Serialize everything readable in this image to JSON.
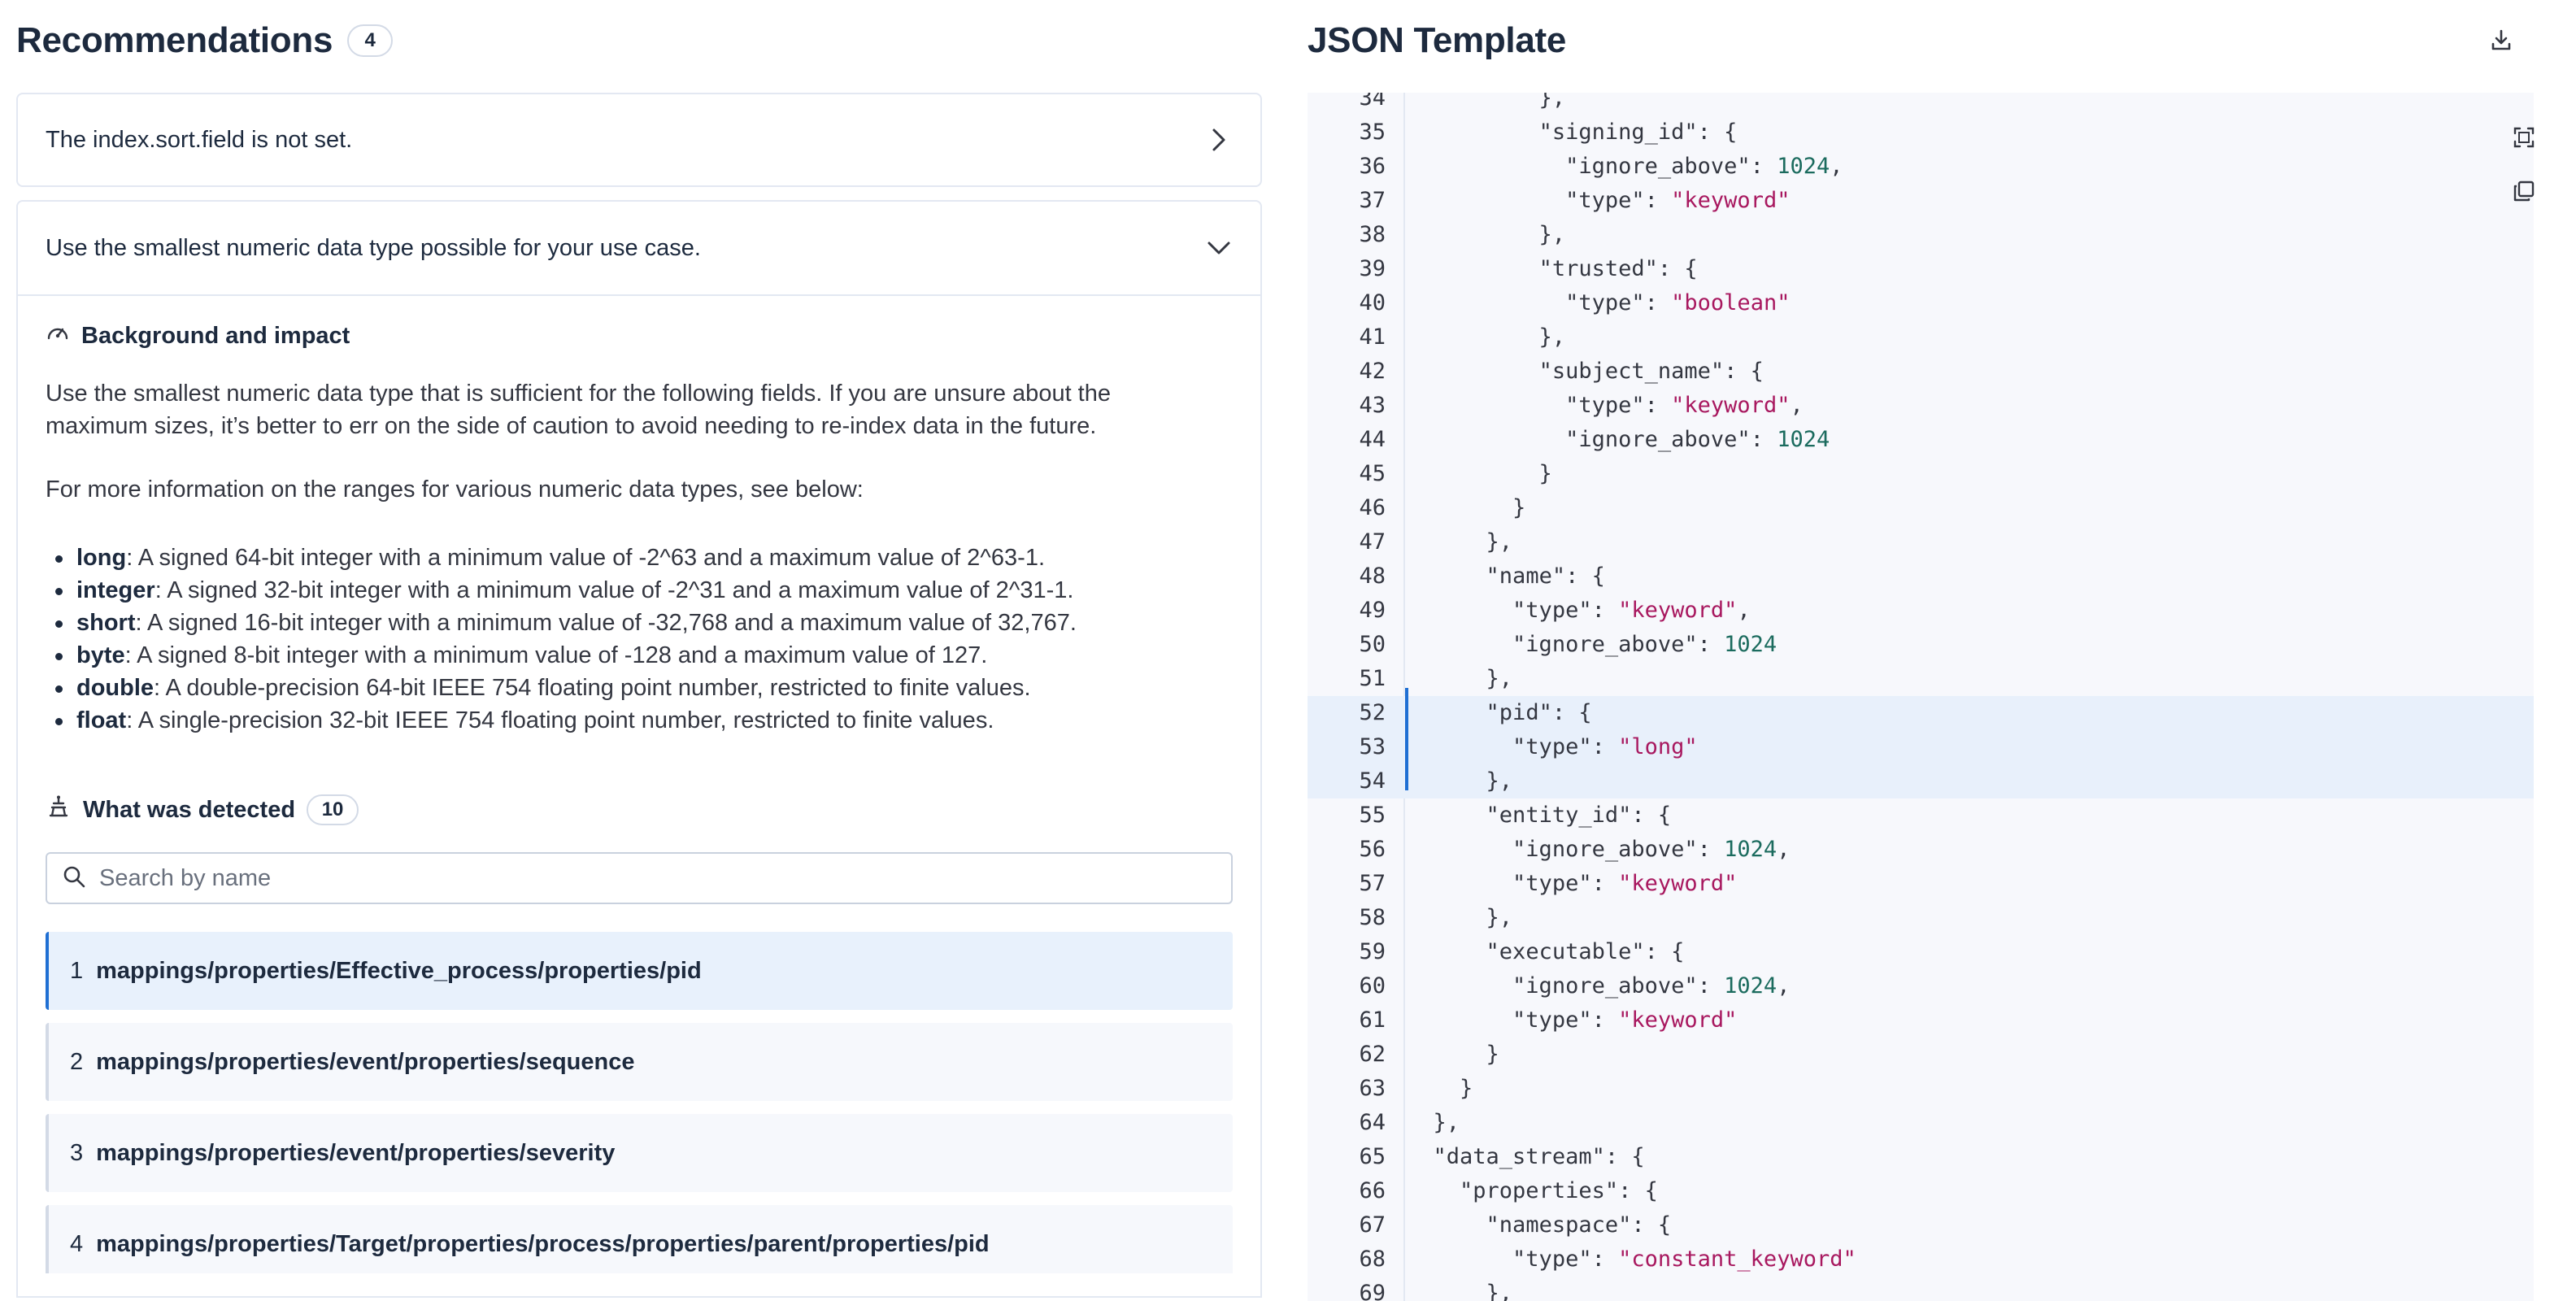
{
  "left": {
    "title": "Recommendations",
    "count": "4",
    "recommendations": [
      {
        "text": "The index.sort.field is not set.",
        "expanded": false
      },
      {
        "text": "Use the smallest numeric data type possible for your use case.",
        "expanded": true
      }
    ],
    "background": {
      "heading": "Background and impact",
      "paragraph1": "Use the smallest numeric data type that is sufficient for the following fields. If you are unsure about the maximum sizes, it’s better to err on the side of caution to avoid needing to re-index data in the future.",
      "paragraph2": "For more information on the ranges for various numeric data types, see below:",
      "types": [
        {
          "name": "long",
          "desc": ": A signed 64-bit integer with a minimum value of -2^63 and a maximum value of 2^63-1."
        },
        {
          "name": "integer",
          "desc": ": A signed 32-bit integer with a minimum value of -2^31 and a maximum value of 2^31-1."
        },
        {
          "name": "short",
          "desc": ": A signed 16-bit integer with a minimum value of -32,768 and a maximum value of 32,767."
        },
        {
          "name": "byte",
          "desc": ": A signed 8-bit integer with a minimum value of -128 and a maximum value of 127."
        },
        {
          "name": "double",
          "desc": ": A double-precision 64-bit IEEE 754 floating point number, restricted to finite values."
        },
        {
          "name": "float",
          "desc": ": A single-precision 32-bit IEEE 754 floating point number, restricted to finite values."
        }
      ]
    },
    "detected": {
      "heading": "What was detected",
      "count": "10",
      "search_placeholder": "Search by name",
      "items": [
        {
          "num": "1",
          "path": "mappings/properties/Effective_process/properties/pid",
          "active": true
        },
        {
          "num": "2",
          "path": "mappings/properties/event/properties/sequence",
          "active": false
        },
        {
          "num": "3",
          "path": "mappings/properties/event/properties/severity",
          "active": false
        },
        {
          "num": "4",
          "path": "mappings/properties/Target/properties/process/properties/parent/properties/pid",
          "active": false
        }
      ]
    }
  },
  "right": {
    "title": "JSON Template",
    "highlight_lines": [
      "52",
      "53",
      "54"
    ],
    "code_lines": [
      {
        "n": "34",
        "t": "          },",
        "partial": true
      },
      {
        "n": "35",
        "t": "          \"signing_id\": {"
      },
      {
        "n": "36",
        "t": "            \"ignore_above\": 1024,"
      },
      {
        "n": "37",
        "t": "            \"type\": \"keyword\""
      },
      {
        "n": "38",
        "t": "          },"
      },
      {
        "n": "39",
        "t": "          \"trusted\": {"
      },
      {
        "n": "40",
        "t": "            \"type\": \"boolean\""
      },
      {
        "n": "41",
        "t": "          },"
      },
      {
        "n": "42",
        "t": "          \"subject_name\": {"
      },
      {
        "n": "43",
        "t": "            \"type\": \"keyword\","
      },
      {
        "n": "44",
        "t": "            \"ignore_above\": 1024"
      },
      {
        "n": "45",
        "t": "          }"
      },
      {
        "n": "46",
        "t": "        }"
      },
      {
        "n": "47",
        "t": "      },"
      },
      {
        "n": "48",
        "t": "      \"name\": {"
      },
      {
        "n": "49",
        "t": "        \"type\": \"keyword\","
      },
      {
        "n": "50",
        "t": "        \"ignore_above\": 1024"
      },
      {
        "n": "51",
        "t": "      },"
      },
      {
        "n": "52",
        "t": "      \"pid\": {"
      },
      {
        "n": "53",
        "t": "        \"type\": \"long\""
      },
      {
        "n": "54",
        "t": "      },"
      },
      {
        "n": "55",
        "t": "      \"entity_id\": {"
      },
      {
        "n": "56",
        "t": "        \"ignore_above\": 1024,"
      },
      {
        "n": "57",
        "t": "        \"type\": \"keyword\""
      },
      {
        "n": "58",
        "t": "      },"
      },
      {
        "n": "59",
        "t": "      \"executable\": {"
      },
      {
        "n": "60",
        "t": "        \"ignore_above\": 1024,"
      },
      {
        "n": "61",
        "t": "        \"type\": \"keyword\""
      },
      {
        "n": "62",
        "t": "      }"
      },
      {
        "n": "63",
        "t": "    }"
      },
      {
        "n": "64",
        "t": "  },"
      },
      {
        "n": "65",
        "t": "  \"data_stream\": {"
      },
      {
        "n": "66",
        "t": "    \"properties\": {"
      },
      {
        "n": "67",
        "t": "      \"namespace\": {"
      },
      {
        "n": "68",
        "t": "        \"type\": \"constant_keyword\""
      },
      {
        "n": "69",
        "t": "      },"
      }
    ]
  },
  "icons": {
    "chevron_right": "chevron-right-icon",
    "chevron_down": "chevron-down-icon",
    "gauge": "gauge-icon",
    "inspect": "inspect-icon",
    "search": "search-icon",
    "download": "download-icon",
    "fullscreen": "fullscreen-icon",
    "copy": "copy-icon"
  },
  "colors": {
    "accent": "#1f6fd3",
    "string": "#a8185f",
    "number": "#1b6b5e",
    "active_row_bg": "#e8f1fc",
    "code_bg": "#f7f8fc"
  }
}
